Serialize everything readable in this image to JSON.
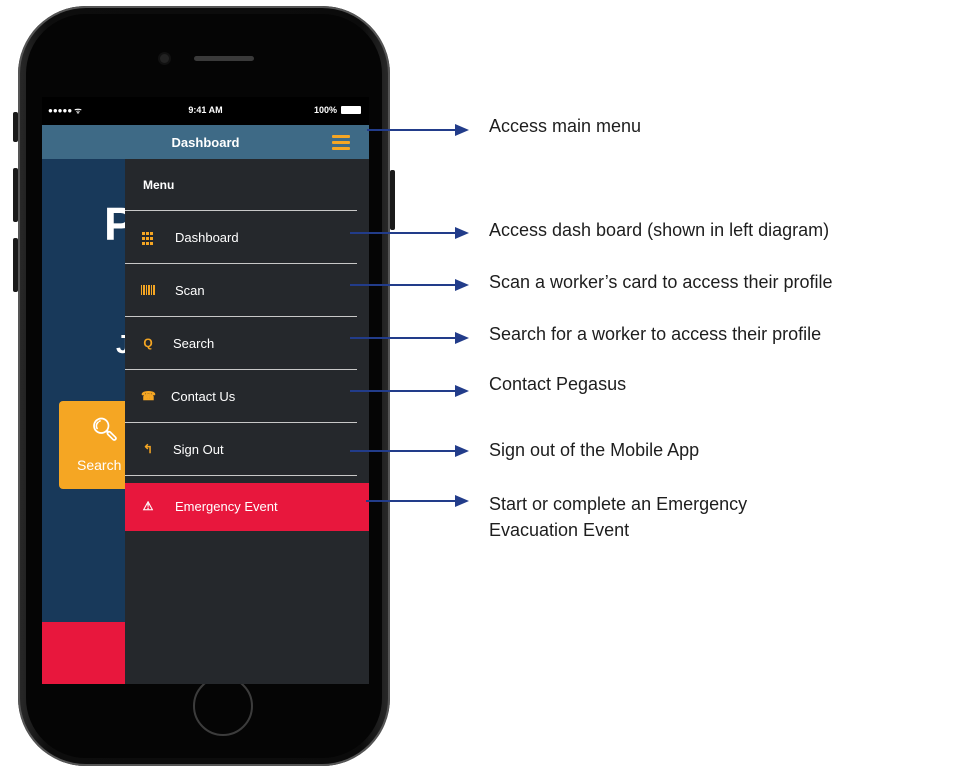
{
  "status_bar": {
    "signal": "●●●●● ᯤ",
    "time": "9:41 AM",
    "battery": "100%"
  },
  "nav": {
    "title": "Dashboard"
  },
  "background": {
    "big_letter": "P",
    "letter_2": "J",
    "search_tile_label": "Search"
  },
  "menu": {
    "title": "Menu",
    "items": [
      {
        "label": "Dashboard",
        "icon": "grid-icon"
      },
      {
        "label": "Scan",
        "icon": "barcode-icon"
      },
      {
        "label": "Search",
        "icon": "search-icon"
      },
      {
        "label": "Contact Us",
        "icon": "phone-icon"
      },
      {
        "label": "Sign Out",
        "icon": "sign-out-icon"
      },
      {
        "label": "Emergency Event",
        "icon": "warning-icon"
      }
    ]
  },
  "annotations": [
    "Access main menu",
    "Access dash board (shown in left diagram)",
    "Scan a worker’s card to access their profile",
    "Search for a worker to access their profile",
    "Contact Pegasus",
    "Sign out of the Mobile App",
    "Start or complete an Emergency",
    "Evacuation Event"
  ],
  "colors": {
    "accent": "#f5a623",
    "nav_bar": "#3e6a86",
    "drawer": "#25282c",
    "emergency": "#e8173d",
    "arrow": "#223c8a"
  }
}
